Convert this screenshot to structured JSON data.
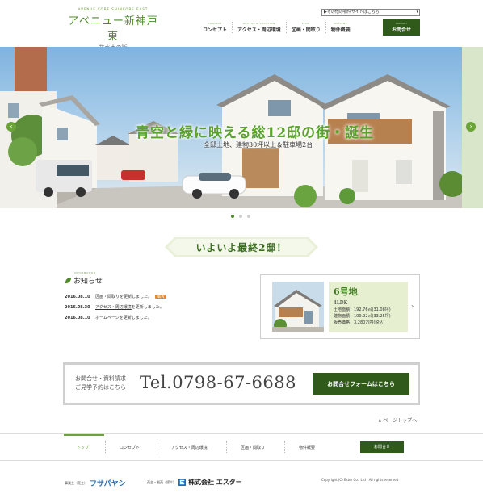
{
  "header": {
    "logo_sub": "AVENUE KOBE SHINKOBE EAST",
    "logo_main": "アベニュー新神戸東",
    "logo_tag": "−花水木の街−",
    "site_select": "▶その他の物件サイトはこちら",
    "nav": [
      {
        "sub": "CONCEPT",
        "label": "コンセプト"
      },
      {
        "sub": "ACCESS & LOCATION",
        "label": "アクセス・周辺環境"
      },
      {
        "sub": "PLAN",
        "label": "区画・間取り"
      },
      {
        "sub": "OUTLINE",
        "label": "物件概要"
      }
    ],
    "contact_sub": "CONTACT",
    "contact_label": "お問合せ"
  },
  "hero": {
    "title": "青空と緑に映える総12邸の街・誕生",
    "subtitle": "全邸土地、建物30坪以上＆駐車場2台",
    "prev": "‹",
    "next": "›"
  },
  "banner": {
    "text": "いよいよ最終2邸！"
  },
  "news": {
    "sub": "INFORMATION",
    "title": "お知らせ",
    "items": [
      {
        "date": "2016.08.10",
        "link": "区画・間取り",
        "rest": "を更新しました。",
        "badge": "NEW"
      },
      {
        "date": "2016.08.30",
        "link": "アクセス・周辺環境",
        "rest": "を更新しました。",
        "badge": ""
      },
      {
        "date": "2016.08.10",
        "link": "",
        "rest": "ホームページを更新しました。",
        "badge": ""
      }
    ]
  },
  "property": {
    "lot": "6号地",
    "plan": "4LDK",
    "specs": [
      "土地面積：192.76㎡(31.08坪)",
      "建物面積：109.92㎡(33.25坪)",
      "販売価格：3,280万円(税込)"
    ],
    "chevron": "›"
  },
  "contact_box": {
    "label_line1": "お問合せ・資料請求",
    "label_line2": "ご見学予約はこちら",
    "tel": "Tel.0798-67-6688",
    "button": "お問合せフォームはこちら"
  },
  "pagetop": "∧ ページトップへ",
  "footer_nav": {
    "items": [
      "トップ",
      "コンセプト",
      "アクセス・周辺環境",
      "区画・間取り",
      "物件概要"
    ],
    "button": "お問合せ"
  },
  "footer": {
    "credit1_label": "事業主（売主）",
    "credit1_brand": "フサパヤシ",
    "credit2_label": "売主・販売（媒介）",
    "credit2_brand": "株式会社 エスター",
    "copyright": "Copyright (C) Ester Co., Ltd . All rights reserved."
  },
  "colors": {
    "accent": "#2f5a19",
    "green": "#6aa337",
    "text": "#333333"
  }
}
